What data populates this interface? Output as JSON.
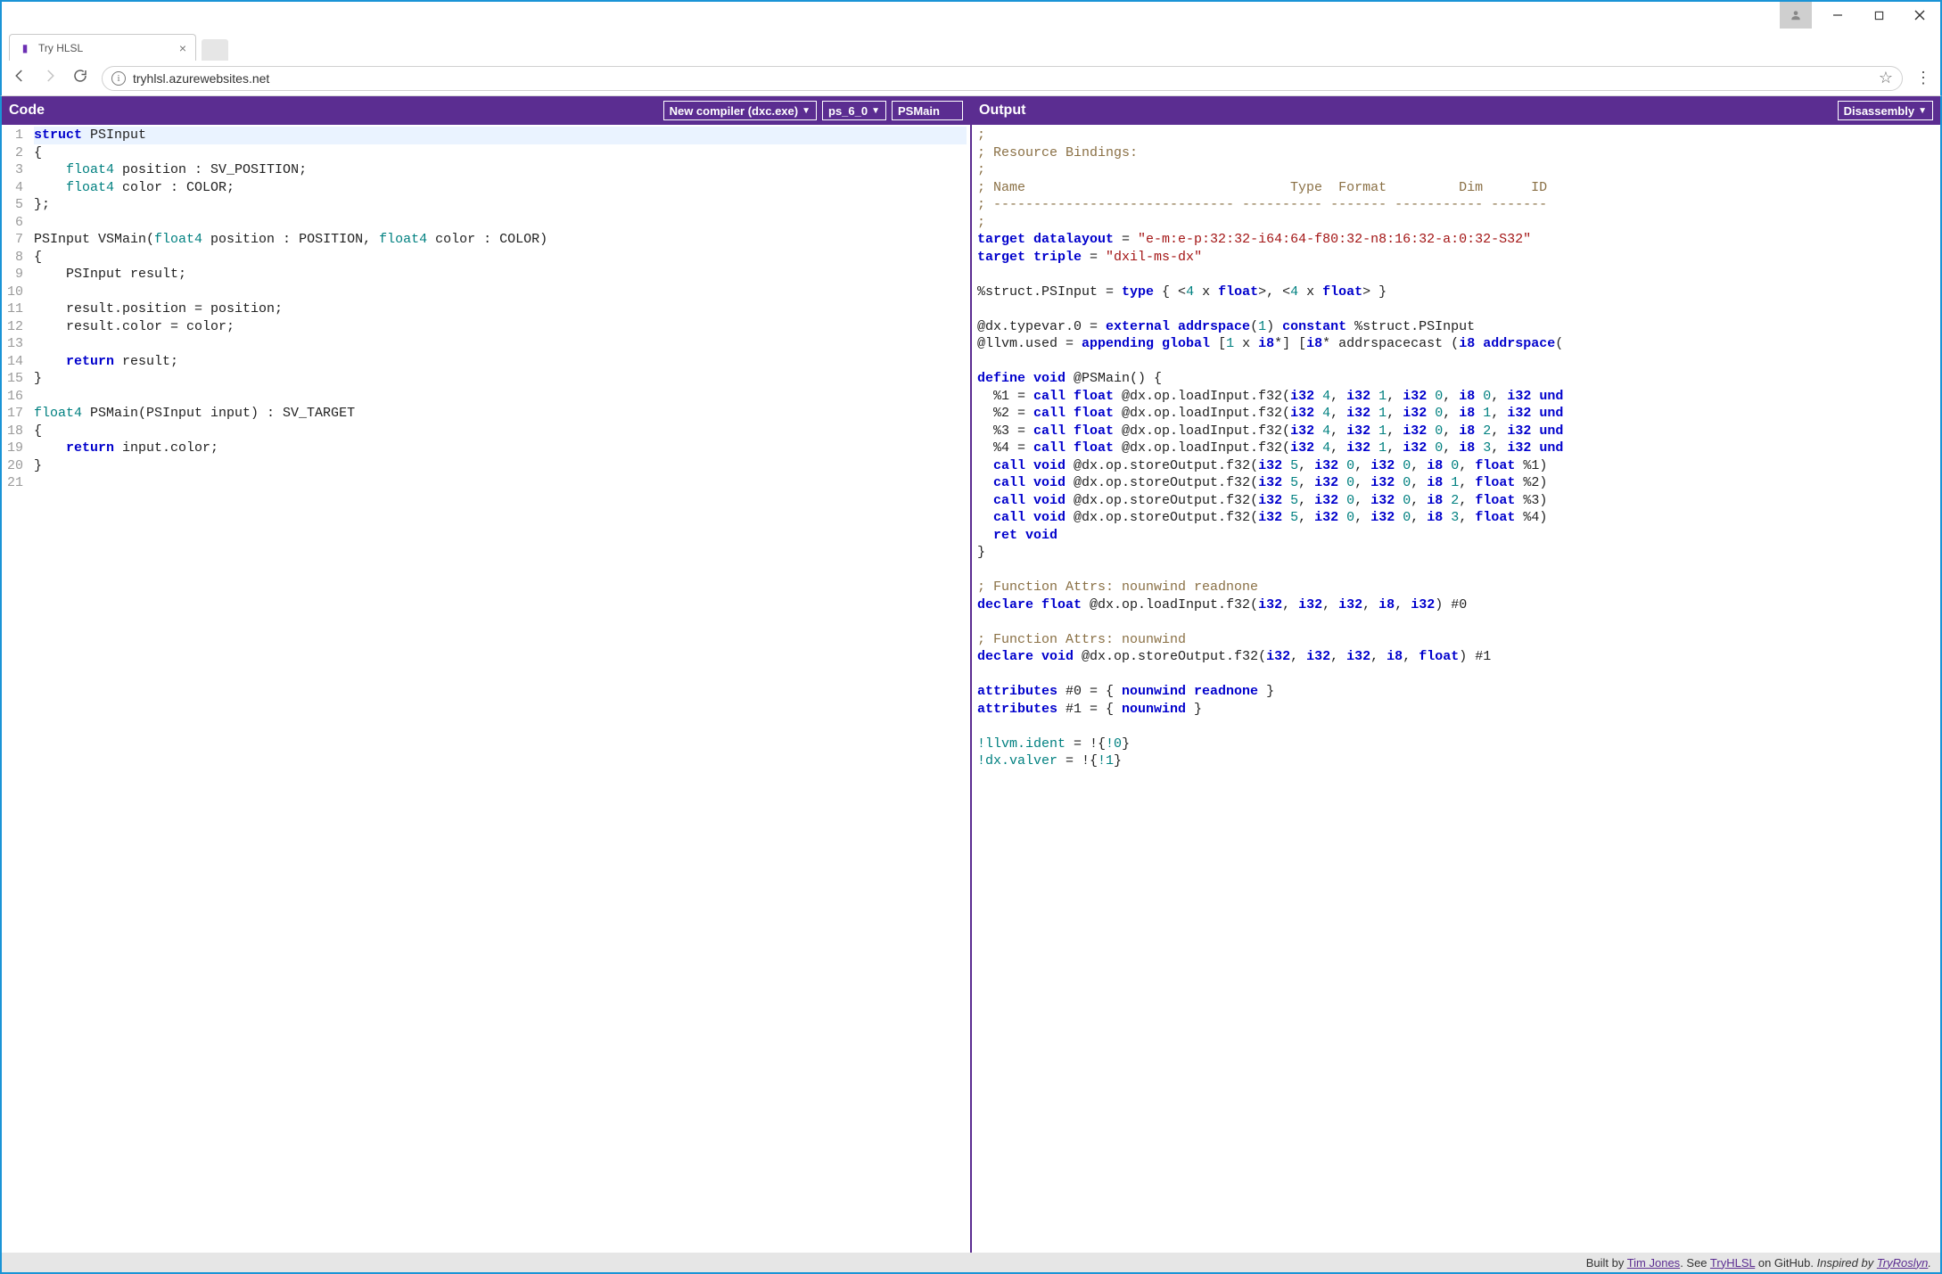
{
  "window": {
    "tab_title": "Try HLSL",
    "url": "tryhlsl.azurewebsites.net"
  },
  "code_pane": {
    "title": "Code",
    "compiler_select": "New compiler (dxc.exe)",
    "profile_select": "ps_6_0",
    "entry_point": "PSMain",
    "source_lines": [
      {
        "n": 1,
        "tokens": [
          {
            "t": "struct",
            "c": "tk-kw"
          },
          {
            "t": " PSInput"
          }
        ]
      },
      {
        "n": 2,
        "tokens": [
          {
            "t": "{"
          }
        ]
      },
      {
        "n": 3,
        "tokens": [
          {
            "t": "    "
          },
          {
            "t": "float4",
            "c": "tk-type"
          },
          {
            "t": " position : SV_POSITION;"
          }
        ]
      },
      {
        "n": 4,
        "tokens": [
          {
            "t": "    "
          },
          {
            "t": "float4",
            "c": "tk-type"
          },
          {
            "t": " color : COLOR;"
          }
        ]
      },
      {
        "n": 5,
        "tokens": [
          {
            "t": "};"
          }
        ]
      },
      {
        "n": 6,
        "tokens": []
      },
      {
        "n": 7,
        "tokens": [
          {
            "t": "PSInput VSMain("
          },
          {
            "t": "float4",
            "c": "tk-type"
          },
          {
            "t": " position : POSITION, "
          },
          {
            "t": "float4",
            "c": "tk-type"
          },
          {
            "t": " color : COLOR)"
          }
        ]
      },
      {
        "n": 8,
        "tokens": [
          {
            "t": "{"
          }
        ]
      },
      {
        "n": 9,
        "tokens": [
          {
            "t": "    PSInput result;"
          }
        ]
      },
      {
        "n": 10,
        "tokens": []
      },
      {
        "n": 11,
        "tokens": [
          {
            "t": "    result.position = position;"
          }
        ]
      },
      {
        "n": 12,
        "tokens": [
          {
            "t": "    result.color = color;"
          }
        ]
      },
      {
        "n": 13,
        "tokens": []
      },
      {
        "n": 14,
        "tokens": [
          {
            "t": "    "
          },
          {
            "t": "return",
            "c": "tk-kw"
          },
          {
            "t": " result;"
          }
        ]
      },
      {
        "n": 15,
        "tokens": [
          {
            "t": "}"
          }
        ]
      },
      {
        "n": 16,
        "tokens": []
      },
      {
        "n": 17,
        "tokens": [
          {
            "t": "float4",
            "c": "tk-type"
          },
          {
            "t": " PSMain(PSInput input) : SV_TARGET"
          }
        ]
      },
      {
        "n": 18,
        "tokens": [
          {
            "t": "{"
          }
        ]
      },
      {
        "n": 19,
        "tokens": [
          {
            "t": "    "
          },
          {
            "t": "return",
            "c": "tk-kw"
          },
          {
            "t": " input.color;"
          }
        ]
      },
      {
        "n": 20,
        "tokens": [
          {
            "t": "}"
          }
        ]
      },
      {
        "n": 21,
        "tokens": []
      }
    ]
  },
  "output_pane": {
    "title": "Output",
    "view_select": "Disassembly",
    "lines": [
      [
        {
          "t": ";",
          "c": "ok-cm"
        }
      ],
      [
        {
          "t": "; Resource Bindings:",
          "c": "ok-cm"
        }
      ],
      [
        {
          "t": ";",
          "c": "ok-cm"
        }
      ],
      [
        {
          "t": "; Name                                 Type  Format         Dim      ID",
          "c": "ok-cm"
        }
      ],
      [
        {
          "t": "; ------------------------------ ---------- ------- ----------- -------",
          "c": "ok-cm"
        }
      ],
      [
        {
          "t": ";",
          "c": "ok-cm"
        }
      ],
      [
        {
          "t": "target datalayout",
          "c": "ok-kw"
        },
        {
          "t": " = "
        },
        {
          "t": "\"e-m:e-p:32:32-i64:64-f80:32-n8:16:32-a:0:32-S32\"",
          "c": "ok-str"
        }
      ],
      [
        {
          "t": "target triple",
          "c": "ok-kw"
        },
        {
          "t": " = "
        },
        {
          "t": "\"dxil-ms-dx\"",
          "c": "ok-str"
        }
      ],
      [],
      [
        {
          "t": "%struct.PSInput = "
        },
        {
          "t": "type",
          "c": "ok-kw"
        },
        {
          "t": " { <"
        },
        {
          "t": "4",
          "c": "ok-num"
        },
        {
          "t": " x "
        },
        {
          "t": "float",
          "c": "ok-kw"
        },
        {
          "t": ">, <"
        },
        {
          "t": "4",
          "c": "ok-num"
        },
        {
          "t": " x "
        },
        {
          "t": "float",
          "c": "ok-kw"
        },
        {
          "t": "> }"
        }
      ],
      [],
      [
        {
          "t": "@dx.typevar.0 = "
        },
        {
          "t": "external addrspace",
          "c": "ok-kw"
        },
        {
          "t": "("
        },
        {
          "t": "1",
          "c": "ok-num"
        },
        {
          "t": ") "
        },
        {
          "t": "constant",
          "c": "ok-kw"
        },
        {
          "t": " %struct.PSInput"
        }
      ],
      [
        {
          "t": "@llvm.used = "
        },
        {
          "t": "appending global",
          "c": "ok-kw"
        },
        {
          "t": " ["
        },
        {
          "t": "1",
          "c": "ok-num"
        },
        {
          "t": " x "
        },
        {
          "t": "i8",
          "c": "ok-kw"
        },
        {
          "t": "*] ["
        },
        {
          "t": "i8",
          "c": "ok-kw"
        },
        {
          "t": "* addrspacecast ("
        },
        {
          "t": "i8 addrspace",
          "c": "ok-kw"
        },
        {
          "t": "("
        }
      ],
      [],
      [
        {
          "t": "define void",
          "c": "ok-kw"
        },
        {
          "t": " @PSMain() {"
        }
      ],
      [
        {
          "t": "  %1 = "
        },
        {
          "t": "call float",
          "c": "ok-kw"
        },
        {
          "t": " @dx.op.loadInput.f32("
        },
        {
          "t": "i32",
          "c": "ok-kw"
        },
        {
          "t": " "
        },
        {
          "t": "4",
          "c": "ok-num"
        },
        {
          "t": ", "
        },
        {
          "t": "i32",
          "c": "ok-kw"
        },
        {
          "t": " "
        },
        {
          "t": "1",
          "c": "ok-num"
        },
        {
          "t": ", "
        },
        {
          "t": "i32",
          "c": "ok-kw"
        },
        {
          "t": " "
        },
        {
          "t": "0",
          "c": "ok-num"
        },
        {
          "t": ", "
        },
        {
          "t": "i8",
          "c": "ok-kw"
        },
        {
          "t": " "
        },
        {
          "t": "0",
          "c": "ok-num"
        },
        {
          "t": ", "
        },
        {
          "t": "i32",
          "c": "ok-kw"
        },
        {
          "t": " "
        },
        {
          "t": "und",
          "c": "ok-kw"
        }
      ],
      [
        {
          "t": "  %2 = "
        },
        {
          "t": "call float",
          "c": "ok-kw"
        },
        {
          "t": " @dx.op.loadInput.f32("
        },
        {
          "t": "i32",
          "c": "ok-kw"
        },
        {
          "t": " "
        },
        {
          "t": "4",
          "c": "ok-num"
        },
        {
          "t": ", "
        },
        {
          "t": "i32",
          "c": "ok-kw"
        },
        {
          "t": " "
        },
        {
          "t": "1",
          "c": "ok-num"
        },
        {
          "t": ", "
        },
        {
          "t": "i32",
          "c": "ok-kw"
        },
        {
          "t": " "
        },
        {
          "t": "0",
          "c": "ok-num"
        },
        {
          "t": ", "
        },
        {
          "t": "i8",
          "c": "ok-kw"
        },
        {
          "t": " "
        },
        {
          "t": "1",
          "c": "ok-num"
        },
        {
          "t": ", "
        },
        {
          "t": "i32",
          "c": "ok-kw"
        },
        {
          "t": " "
        },
        {
          "t": "und",
          "c": "ok-kw"
        }
      ],
      [
        {
          "t": "  %3 = "
        },
        {
          "t": "call float",
          "c": "ok-kw"
        },
        {
          "t": " @dx.op.loadInput.f32("
        },
        {
          "t": "i32",
          "c": "ok-kw"
        },
        {
          "t": " "
        },
        {
          "t": "4",
          "c": "ok-num"
        },
        {
          "t": ", "
        },
        {
          "t": "i32",
          "c": "ok-kw"
        },
        {
          "t": " "
        },
        {
          "t": "1",
          "c": "ok-num"
        },
        {
          "t": ", "
        },
        {
          "t": "i32",
          "c": "ok-kw"
        },
        {
          "t": " "
        },
        {
          "t": "0",
          "c": "ok-num"
        },
        {
          "t": ", "
        },
        {
          "t": "i8",
          "c": "ok-kw"
        },
        {
          "t": " "
        },
        {
          "t": "2",
          "c": "ok-num"
        },
        {
          "t": ", "
        },
        {
          "t": "i32",
          "c": "ok-kw"
        },
        {
          "t": " "
        },
        {
          "t": "und",
          "c": "ok-kw"
        }
      ],
      [
        {
          "t": "  %4 = "
        },
        {
          "t": "call float",
          "c": "ok-kw"
        },
        {
          "t": " @dx.op.loadInput.f32("
        },
        {
          "t": "i32",
          "c": "ok-kw"
        },
        {
          "t": " "
        },
        {
          "t": "4",
          "c": "ok-num"
        },
        {
          "t": ", "
        },
        {
          "t": "i32",
          "c": "ok-kw"
        },
        {
          "t": " "
        },
        {
          "t": "1",
          "c": "ok-num"
        },
        {
          "t": ", "
        },
        {
          "t": "i32",
          "c": "ok-kw"
        },
        {
          "t": " "
        },
        {
          "t": "0",
          "c": "ok-num"
        },
        {
          "t": ", "
        },
        {
          "t": "i8",
          "c": "ok-kw"
        },
        {
          "t": " "
        },
        {
          "t": "3",
          "c": "ok-num"
        },
        {
          "t": ", "
        },
        {
          "t": "i32",
          "c": "ok-kw"
        },
        {
          "t": " "
        },
        {
          "t": "und",
          "c": "ok-kw"
        }
      ],
      [
        {
          "t": "  "
        },
        {
          "t": "call void",
          "c": "ok-kw"
        },
        {
          "t": " @dx.op.storeOutput.f32("
        },
        {
          "t": "i32",
          "c": "ok-kw"
        },
        {
          "t": " "
        },
        {
          "t": "5",
          "c": "ok-num"
        },
        {
          "t": ", "
        },
        {
          "t": "i32",
          "c": "ok-kw"
        },
        {
          "t": " "
        },
        {
          "t": "0",
          "c": "ok-num"
        },
        {
          "t": ", "
        },
        {
          "t": "i32",
          "c": "ok-kw"
        },
        {
          "t": " "
        },
        {
          "t": "0",
          "c": "ok-num"
        },
        {
          "t": ", "
        },
        {
          "t": "i8",
          "c": "ok-kw"
        },
        {
          "t": " "
        },
        {
          "t": "0",
          "c": "ok-num"
        },
        {
          "t": ", "
        },
        {
          "t": "float",
          "c": "ok-kw"
        },
        {
          "t": " %1)"
        }
      ],
      [
        {
          "t": "  "
        },
        {
          "t": "call void",
          "c": "ok-kw"
        },
        {
          "t": " @dx.op.storeOutput.f32("
        },
        {
          "t": "i32",
          "c": "ok-kw"
        },
        {
          "t": " "
        },
        {
          "t": "5",
          "c": "ok-num"
        },
        {
          "t": ", "
        },
        {
          "t": "i32",
          "c": "ok-kw"
        },
        {
          "t": " "
        },
        {
          "t": "0",
          "c": "ok-num"
        },
        {
          "t": ", "
        },
        {
          "t": "i32",
          "c": "ok-kw"
        },
        {
          "t": " "
        },
        {
          "t": "0",
          "c": "ok-num"
        },
        {
          "t": ", "
        },
        {
          "t": "i8",
          "c": "ok-kw"
        },
        {
          "t": " "
        },
        {
          "t": "1",
          "c": "ok-num"
        },
        {
          "t": ", "
        },
        {
          "t": "float",
          "c": "ok-kw"
        },
        {
          "t": " %2)"
        }
      ],
      [
        {
          "t": "  "
        },
        {
          "t": "call void",
          "c": "ok-kw"
        },
        {
          "t": " @dx.op.storeOutput.f32("
        },
        {
          "t": "i32",
          "c": "ok-kw"
        },
        {
          "t": " "
        },
        {
          "t": "5",
          "c": "ok-num"
        },
        {
          "t": ", "
        },
        {
          "t": "i32",
          "c": "ok-kw"
        },
        {
          "t": " "
        },
        {
          "t": "0",
          "c": "ok-num"
        },
        {
          "t": ", "
        },
        {
          "t": "i32",
          "c": "ok-kw"
        },
        {
          "t": " "
        },
        {
          "t": "0",
          "c": "ok-num"
        },
        {
          "t": ", "
        },
        {
          "t": "i8",
          "c": "ok-kw"
        },
        {
          "t": " "
        },
        {
          "t": "2",
          "c": "ok-num"
        },
        {
          "t": ", "
        },
        {
          "t": "float",
          "c": "ok-kw"
        },
        {
          "t": " %3)"
        }
      ],
      [
        {
          "t": "  "
        },
        {
          "t": "call void",
          "c": "ok-kw"
        },
        {
          "t": " @dx.op.storeOutput.f32("
        },
        {
          "t": "i32",
          "c": "ok-kw"
        },
        {
          "t": " "
        },
        {
          "t": "5",
          "c": "ok-num"
        },
        {
          "t": ", "
        },
        {
          "t": "i32",
          "c": "ok-kw"
        },
        {
          "t": " "
        },
        {
          "t": "0",
          "c": "ok-num"
        },
        {
          "t": ", "
        },
        {
          "t": "i32",
          "c": "ok-kw"
        },
        {
          "t": " "
        },
        {
          "t": "0",
          "c": "ok-num"
        },
        {
          "t": ", "
        },
        {
          "t": "i8",
          "c": "ok-kw"
        },
        {
          "t": " "
        },
        {
          "t": "3",
          "c": "ok-num"
        },
        {
          "t": ", "
        },
        {
          "t": "float",
          "c": "ok-kw"
        },
        {
          "t": " %4)"
        }
      ],
      [
        {
          "t": "  "
        },
        {
          "t": "ret void",
          "c": "ok-kw"
        }
      ],
      [
        {
          "t": "}"
        }
      ],
      [],
      [
        {
          "t": "; Function Attrs: nounwind readnone",
          "c": "ok-cm"
        }
      ],
      [
        {
          "t": "declare float",
          "c": "ok-kw"
        },
        {
          "t": " @dx.op.loadInput.f32("
        },
        {
          "t": "i32",
          "c": "ok-kw"
        },
        {
          "t": ", "
        },
        {
          "t": "i32",
          "c": "ok-kw"
        },
        {
          "t": ", "
        },
        {
          "t": "i32",
          "c": "ok-kw"
        },
        {
          "t": ", "
        },
        {
          "t": "i8",
          "c": "ok-kw"
        },
        {
          "t": ", "
        },
        {
          "t": "i32",
          "c": "ok-kw"
        },
        {
          "t": ") #0"
        }
      ],
      [],
      [
        {
          "t": "; Function Attrs: nounwind",
          "c": "ok-cm"
        }
      ],
      [
        {
          "t": "declare void",
          "c": "ok-kw"
        },
        {
          "t": " @dx.op.storeOutput.f32("
        },
        {
          "t": "i32",
          "c": "ok-kw"
        },
        {
          "t": ", "
        },
        {
          "t": "i32",
          "c": "ok-kw"
        },
        {
          "t": ", "
        },
        {
          "t": "i32",
          "c": "ok-kw"
        },
        {
          "t": ", "
        },
        {
          "t": "i8",
          "c": "ok-kw"
        },
        {
          "t": ", "
        },
        {
          "t": "float",
          "c": "ok-kw"
        },
        {
          "t": ") #1"
        }
      ],
      [],
      [
        {
          "t": "attributes",
          "c": "ok-kw"
        },
        {
          "t": " #0 = { "
        },
        {
          "t": "nounwind readnone",
          "c": "ok-kw"
        },
        {
          "t": " }"
        }
      ],
      [
        {
          "t": "attributes",
          "c": "ok-kw"
        },
        {
          "t": " #1 = { "
        },
        {
          "t": "nounwind",
          "c": "ok-kw"
        },
        {
          "t": " }"
        }
      ],
      [],
      [
        {
          "t": "!llvm.ident",
          "c": "ok-id"
        },
        {
          "t": " = !{"
        },
        {
          "t": "!0",
          "c": "ok-id"
        },
        {
          "t": "}"
        }
      ],
      [
        {
          "t": "!dx.valver",
          "c": "ok-id"
        },
        {
          "t": " = !{"
        },
        {
          "t": "!1",
          "c": "ok-id"
        },
        {
          "t": "}"
        }
      ]
    ]
  },
  "footer": {
    "built_by_prefix": "Built by ",
    "built_by_name": "Tim Jones",
    "see_prefix": ". See ",
    "see_link": "TryHLSL",
    "see_suffix": " on GitHub. ",
    "inspired_prefix": "Inspired by ",
    "inspired_link": "TryRoslyn",
    "period": "."
  }
}
